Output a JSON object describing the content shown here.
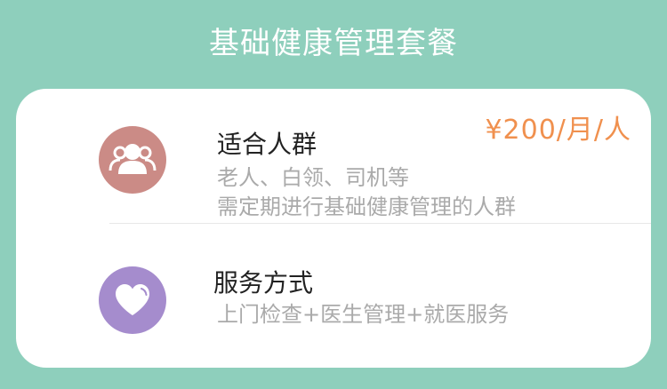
{
  "header": {
    "title": "基础健康管理套餐"
  },
  "card": {
    "price": "¥200/月/人",
    "audience": {
      "icon": "group-people-icon",
      "title": "适合人群",
      "line1": "老人、白领、司机等",
      "line2": "需定期进行基础健康管理的人群"
    },
    "service": {
      "icon": "heart-icon",
      "title": "服务方式",
      "line1": "上门检查+医生管理+就医服务"
    }
  },
  "colors": {
    "background": "#8ecfbc",
    "card": "#ffffff",
    "price": "#f0904e",
    "people_icon_bg": "#cb8b86",
    "heart_icon_bg": "#a58ccd",
    "title_text": "#222222",
    "desc_text": "#aaaaaa"
  }
}
